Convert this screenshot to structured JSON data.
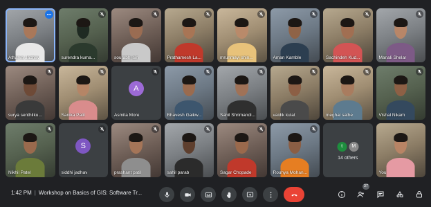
{
  "participants": [
    {
      "name": "Atharva Jadhav",
      "type": "camera",
      "tint": "c4",
      "skin": "#a9785a",
      "shirt": "#e8e8e8",
      "selected": true
    },
    {
      "name": "surendra kuma...",
      "type": "camera",
      "tint": "c6",
      "skin": "#1f2a22",
      "shirt": "#2b3a2d",
      "muted": true
    },
    {
      "name": "sourabh jsin",
      "type": "camera",
      "tint": "c3",
      "skin": "#9a6c52",
      "shirt": "#c9c9c9",
      "muted": true
    },
    {
      "name": "Prathamesh La...",
      "type": "camera",
      "tint": "c2",
      "skin": "#a87555",
      "shirt": "#c0392b",
      "muted": true
    },
    {
      "name": "mrunmayi shin...",
      "type": "camera",
      "tint": "c5",
      "skin": "#b98a6a",
      "shirt": "#e8c27a",
      "muted": true
    },
    {
      "name": "Aman Kamble",
      "type": "camera",
      "tint": "c1",
      "skin": "#8f6347",
      "shirt": "#2c3e50",
      "muted": true
    },
    {
      "name": "Sachindeh Kud...",
      "type": "camera",
      "tint": "c2",
      "skin": "#a16f52",
      "shirt": "#d35454",
      "muted": true
    },
    {
      "name": "Manali Shelar",
      "type": "camera",
      "tint": "c4",
      "skin": "#b88668",
      "shirt": "#7d5a86",
      "muted": true
    },
    {
      "name": "surya senthilku...",
      "type": "camera",
      "tint": "c3",
      "skin": "#6e4a37",
      "shirt": "#3a3a3a",
      "muted": true
    },
    {
      "name": "Sanika Patil",
      "type": "camera",
      "tint": "c5",
      "skin": "#b58566",
      "shirt": "#d98c8c",
      "muted": true
    },
    {
      "name": "Asmita More",
      "type": "avatar",
      "initial": "A",
      "avatarColor": "#9c6ad6",
      "muted": true
    },
    {
      "name": "Bhavesh Gaikw...",
      "type": "camera",
      "tint": "c1",
      "skin": "#9a6b4f",
      "shirt": "#3d566e",
      "muted": true
    },
    {
      "name": "Sahil Shrimandi...",
      "type": "camera",
      "tint": "c4",
      "skin": "#a07257",
      "shirt": "#2f2f2f",
      "muted": true
    },
    {
      "name": "vaidik kulat",
      "type": "camera",
      "tint": "c2",
      "skin": "#8c5f45",
      "shirt": "#4a4a4a",
      "muted": true
    },
    {
      "name": "meghal sathe",
      "type": "camera",
      "tint": "c5",
      "skin": "#a97c5f",
      "shirt": "#5d7b8f",
      "muted": true
    },
    {
      "name": "Vishal Nikam",
      "type": "camera",
      "tint": "c6",
      "skin": "#8d6045",
      "shirt": "#34495e",
      "muted": true
    },
    {
      "name": "Nikhil Patel",
      "type": "camera",
      "tint": "c6",
      "skin": "#9a6a4d",
      "shirt": "#6b7b3a",
      "muted": true
    },
    {
      "name": "siddhi jadhav",
      "type": "avatar",
      "initial": "S",
      "avatarColor": "#7e57c2",
      "muted": true
    },
    {
      "name": "prashant patil",
      "type": "camera",
      "tint": "c3",
      "skin": "#a57558",
      "shirt": "#8e8e8e",
      "muted": true
    },
    {
      "name": "sahil parab",
      "type": "camera",
      "tint": "c4",
      "skin": "#5e3f2e",
      "shirt": "#2b2b2b",
      "muted": true
    },
    {
      "name": "Sagar Chopade",
      "type": "camera",
      "tint": "c3",
      "skin": "#9a694c",
      "shirt": "#c0392b",
      "muted": true
    },
    {
      "name": "Rouhya Mohan...",
      "type": "camera",
      "tint": "c1",
      "skin": "#8b5e44",
      "shirt": "#e67e22",
      "muted": true
    },
    {
      "name": "14 others",
      "type": "others",
      "initials": [
        "t",
        "M"
      ],
      "initialColors": [
        "#1e8e3e",
        "#8a8a8a"
      ]
    },
    {
      "name": "You",
      "type": "camera",
      "tint": "c2",
      "skin": "#b88465",
      "shirt": "#e59aa3"
    }
  ],
  "tile_more_icon": "more-vert-icon",
  "mic_off_icon": "mic-off-icon",
  "bottom_bar": {
    "time": "1:42 PM",
    "separator": "|",
    "meeting_title": "Workshop on Basics of GIS: Software Tr...",
    "controls": [
      {
        "name": "mic-button",
        "icon": "mic-icon"
      },
      {
        "name": "camera-button",
        "icon": "camera-icon"
      },
      {
        "name": "captions-button",
        "icon": "captions-icon"
      },
      {
        "name": "raise-hand-button",
        "icon": "hand-icon"
      },
      {
        "name": "present-button",
        "icon": "present-icon"
      },
      {
        "name": "more-options-button",
        "icon": "more-vert-icon"
      },
      {
        "name": "leave-call-button",
        "icon": "phone-end-icon"
      }
    ],
    "people_count": "37",
    "right_icons": [
      "info-icon",
      "people-icon",
      "chat-icon",
      "activities-icon",
      "lock-icon"
    ]
  },
  "colors": {
    "background": "#202124",
    "tile": "#3c4043",
    "selected": "#8ab4f8",
    "end_call": "#ea4335",
    "accent": "#1a73e8"
  }
}
